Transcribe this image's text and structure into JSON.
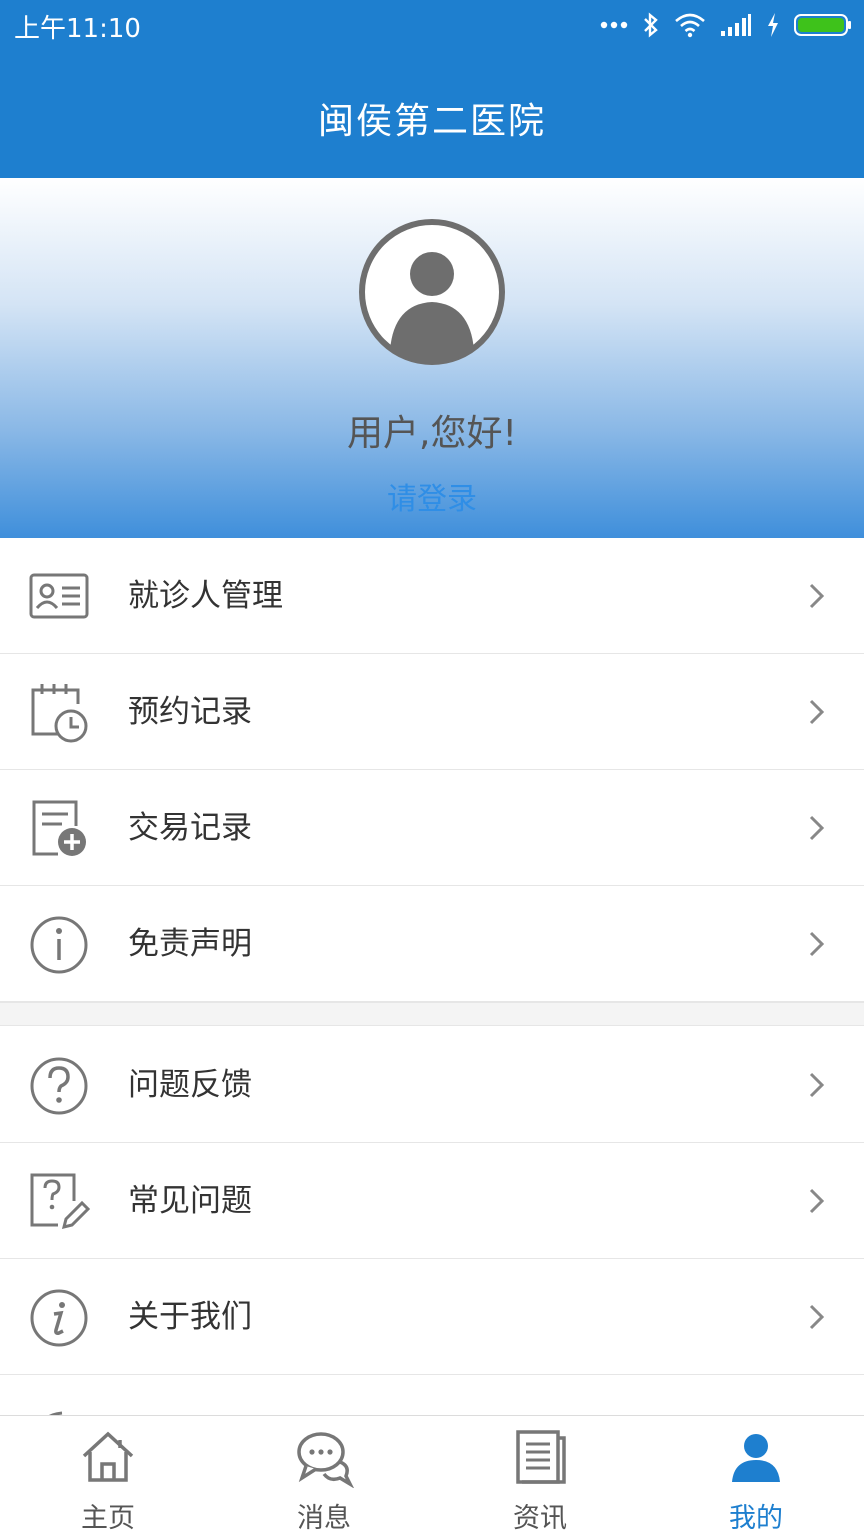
{
  "status_bar": {
    "time": "上午11:10"
  },
  "header": {
    "title": "闽侯第二医院"
  },
  "profile": {
    "greeting": "用户,您好!",
    "login_link": "请登录"
  },
  "menu_group_1": [
    {
      "label": "就诊人管理",
      "icon": "id-card-icon"
    },
    {
      "label": "预约记录",
      "icon": "calendar-clock-icon"
    },
    {
      "label": "交易记录",
      "icon": "document-plus-icon"
    },
    {
      "label": "免责声明",
      "icon": "info-circle-icon"
    }
  ],
  "menu_group_2": [
    {
      "label": "问题反馈",
      "icon": "question-circle-icon"
    },
    {
      "label": "常见问题",
      "icon": "question-edit-icon"
    },
    {
      "label": "关于我们",
      "icon": "info-italic-icon"
    }
  ],
  "tabbar": [
    {
      "label": "主页",
      "icon": "home-icon",
      "active": false
    },
    {
      "label": "消息",
      "icon": "chat-icon",
      "active": false
    },
    {
      "label": "资讯",
      "icon": "news-icon",
      "active": false
    },
    {
      "label": "我的",
      "icon": "user-icon",
      "active": true
    }
  ],
  "colors": {
    "primary": "#1e7fcf",
    "link": "#2f8ee6",
    "icon_gray": "#777777",
    "battery_green": "#3ec21b"
  }
}
